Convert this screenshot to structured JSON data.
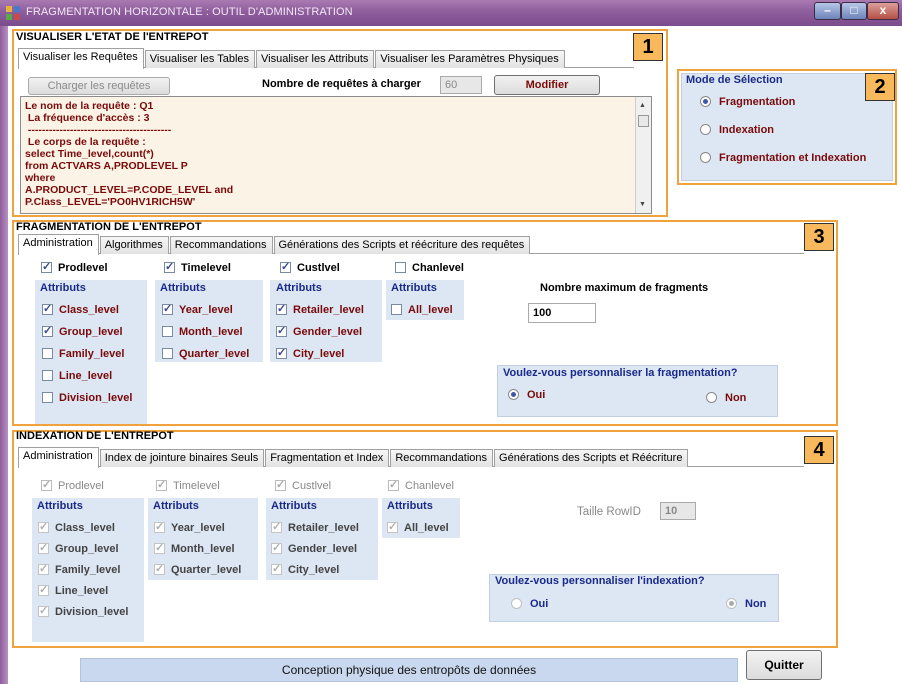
{
  "window": {
    "title": "FRAGMENTATION HORIZONTALE : OUTIL D'ADMINISTRATION",
    "controls": [
      "–",
      "□",
      "x"
    ]
  },
  "section1": {
    "title": "VISUALISER L'ETAT DE l'ENTREPOT",
    "badge": "1",
    "tabs": [
      "Visualiser les Requêtes",
      "Visualiser les Tables",
      "Visualiser les Attributs",
      "Visualiser les Paramètres Physiques"
    ],
    "load_button": "Charger les requêtes",
    "count_label": "Nombre de requêtes à charger",
    "count_value": "60",
    "modify_button": "Modifier",
    "query_lines": [
      "Le nom de la requête : Q1",
      " La fréquence d'accès : 3",
      " -----------------------------------------",
      " Le corps de la requête :",
      "",
      "select Time_level,count(*)",
      "from ACTVARS A,PRODLEVEL P",
      "where",
      "A.PRODUCT_LEVEL=P.CODE_LEVEL and",
      "P.Class_LEVEL='PO0HV1RICH5W'"
    ]
  },
  "section2": {
    "badge": "2",
    "title": "Mode de Sélection",
    "options": [
      "Fragmentation",
      "Indexation",
      "Fragmentation et Indexation"
    ],
    "selected": "Fragmentation"
  },
  "section3": {
    "title": "FRAGMENTATION DE L'ENTREPOT",
    "badge": "3",
    "tabs": [
      "Administration",
      "Algorithmes",
      "Recommandations",
      "Générations des Scripts et réécriture des requêtes"
    ],
    "dimensions": [
      {
        "name": "Prodlevel",
        "checked": true
      },
      {
        "name": "Timelevel",
        "checked": true
      },
      {
        "name": "Custlvel",
        "checked": true
      },
      {
        "name": "Chanlevel",
        "checked": false
      }
    ],
    "attributes_label": "Attributs",
    "groups": [
      [
        {
          "name": "Class_level",
          "checked": true
        },
        {
          "name": "Group_level",
          "checked": true
        },
        {
          "name": "Family_level",
          "checked": false
        },
        {
          "name": "Line_level",
          "checked": false
        },
        {
          "name": "Division_level",
          "checked": false
        }
      ],
      [
        {
          "name": "Year_level",
          "checked": true
        },
        {
          "name": "Month_level",
          "checked": false
        },
        {
          "name": "Quarter_level",
          "checked": false
        }
      ],
      [
        {
          "name": "Retailer_level",
          "checked": true
        },
        {
          "name": "Gender_level",
          "checked": true
        },
        {
          "name": "City_level",
          "checked": true
        }
      ],
      [
        {
          "name": "All_level",
          "checked": false
        }
      ]
    ],
    "max_fragments_label": "Nombre maximum de fragments",
    "max_fragments_value": "100",
    "personalize_question": "Voulez-vous personnaliser la fragmentation?",
    "yes": "Oui",
    "no": "Non",
    "selected": "Oui"
  },
  "section4": {
    "title": "INDEXATION DE L'ENTREPOT",
    "badge": "4",
    "tabs": [
      "Administration",
      "Index de jointure binaires  Seuls",
      "Fragmentation et Index",
      "Recommandations",
      "Générations des Scripts et Réécriture"
    ],
    "dimensions": [
      {
        "name": "Prodlevel",
        "checked": true
      },
      {
        "name": "Timelevel",
        "checked": true
      },
      {
        "name": "Custlvel",
        "checked": true
      },
      {
        "name": "Chanlevel",
        "checked": true
      }
    ],
    "attributes_label": "Attributs",
    "groups": [
      [
        {
          "name": "Class_level",
          "checked": true
        },
        {
          "name": "Group_level",
          "checked": true
        },
        {
          "name": "Family_level",
          "checked": true
        },
        {
          "name": "Line_level",
          "checked": true
        },
        {
          "name": "Division_level",
          "checked": true
        }
      ],
      [
        {
          "name": "Year_level",
          "checked": true
        },
        {
          "name": "Month_level",
          "checked": true
        },
        {
          "name": "Quarter_level",
          "checked": true
        }
      ],
      [
        {
          "name": "Retailer_level",
          "checked": true
        },
        {
          "name": "Gender_level",
          "checked": true
        },
        {
          "name": "City_level",
          "checked": true
        }
      ],
      [
        {
          "name": "All_level",
          "checked": true
        }
      ]
    ],
    "rowid_label": "Taille RowID",
    "rowid_value": "10",
    "personalize_question": "Voulez-vous personnaliser l'indexation?",
    "yes": "Oui",
    "no": "Non",
    "selected": "Non"
  },
  "footer": {
    "status": "Conception physique des entropôts de données",
    "quit_button": "Quitter"
  },
  "colors": {
    "title_bar": "#8e5d9c",
    "highlight_border": "#f0a23c",
    "badge_fill": "#f7b95b",
    "panel_blue": "#dde6f3",
    "query_text": "#7a0a0a"
  }
}
